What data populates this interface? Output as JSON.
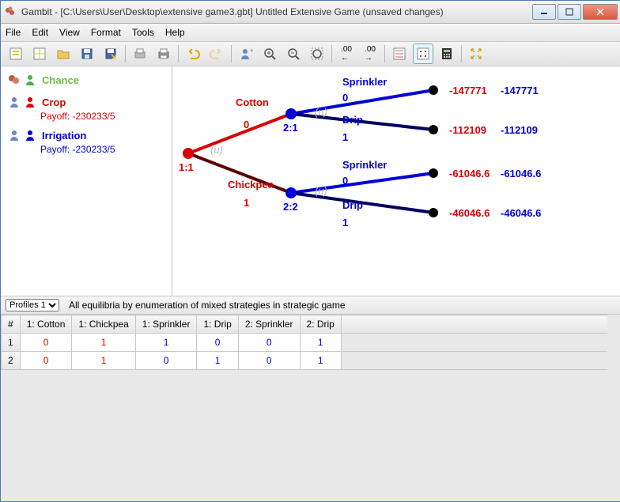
{
  "window": {
    "title": "Gambit - [C:\\Users\\User\\Desktop\\extensive game3.gbt] Untitled Extensive Game (unsaved changes)"
  },
  "menubar": [
    "File",
    "Edit",
    "View",
    "Format",
    "Tools",
    "Help"
  ],
  "players": {
    "chance": {
      "label": "Chance"
    },
    "crop": {
      "label": "Crop",
      "payoff": "Payoff: -230233/5"
    },
    "irrigation": {
      "label": "Irrigation",
      "payoff": "Payoff: -230233/5"
    }
  },
  "tree": {
    "root": {
      "label": "1:1"
    },
    "cotton": {
      "label": "Cotton",
      "index": "0",
      "node": "2:1",
      "u": "(u)"
    },
    "chickpea": {
      "label": "Chickpea",
      "index": "1",
      "node": "2:2",
      "u": "(u)"
    },
    "leaves": {
      "cotton_sprinkler": {
        "label": "Sprinkler",
        "index": "0",
        "p1": "-147771",
        "p2": "-147771"
      },
      "cotton_drip": {
        "label": "Drip",
        "index": "1",
        "p1": "-112109",
        "p2": "-112109"
      },
      "chickpea_sprinkler": {
        "label": "Sprinkler",
        "index": "0",
        "p1": "-61046.6",
        "p2": "-61046.6"
      },
      "chickpea_drip": {
        "label": "Drip",
        "index": "1",
        "p1": "-46046.6",
        "p2": "-46046.6"
      }
    }
  },
  "profiles": {
    "selector": "Profiles 1",
    "status": "All equilibria by enumeration of mixed strategies in strategic game",
    "headers": [
      "#",
      "1: Cotton",
      "1: Chickpea",
      "1: Sprinkler",
      "1: Drip",
      "2: Sprinkler",
      "2: Drip"
    ],
    "rows": [
      {
        "n": "1",
        "v": [
          "0",
          "1",
          "1",
          "0",
          "0",
          "1"
        ]
      },
      {
        "n": "2",
        "v": [
          "0",
          "1",
          "0",
          "1",
          "0",
          "1"
        ]
      }
    ]
  }
}
